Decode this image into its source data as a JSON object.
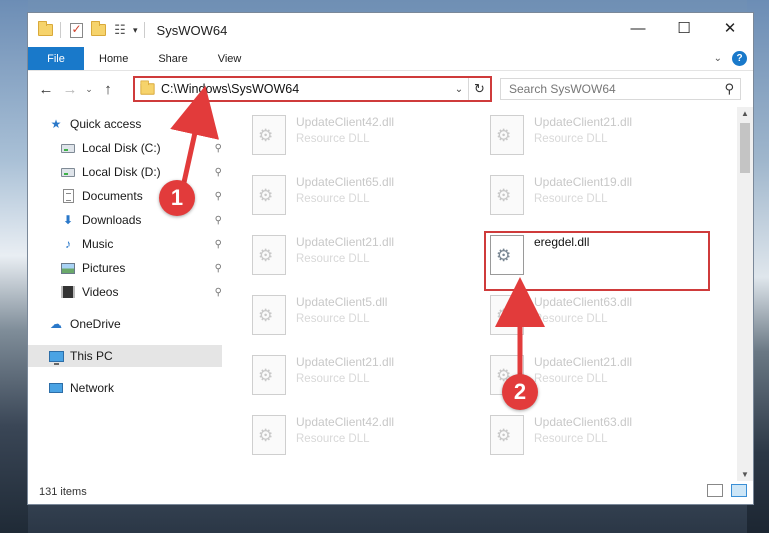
{
  "window": {
    "title": "SysWOW64"
  },
  "window_controls": {
    "minimize": "—",
    "maximize": "☐",
    "close": "✕"
  },
  "ribbon": {
    "tabs": [
      "File",
      "Home",
      "Share",
      "View"
    ],
    "collapse": "⌄",
    "help": "?"
  },
  "address_bar": {
    "path": "C:\\Windows\\SysWOW64",
    "dropdown": "⌄",
    "refresh": "↻"
  },
  "search": {
    "placeholder": "Search SysWOW64",
    "icon": "⚲"
  },
  "nav_buttons": {
    "back": "←",
    "forward": "→",
    "recent": "⌄",
    "up": "↑"
  },
  "sidebar": {
    "quick_access": "Quick access",
    "items": [
      {
        "label": "Local Disk (C:)",
        "icon": "drive-icon",
        "pinned": true
      },
      {
        "label": "Local Disk (D:)",
        "icon": "drive-icon",
        "pinned": true
      },
      {
        "label": "Documents",
        "icon": "documents-icon",
        "pinned": true
      },
      {
        "label": "Downloads",
        "icon": "downloads-icon",
        "pinned": true
      },
      {
        "label": "Music",
        "icon": "music-icon",
        "pinned": true
      },
      {
        "label": "Pictures",
        "icon": "pictures-icon",
        "pinned": true
      },
      {
        "label": "Videos",
        "icon": "videos-icon",
        "pinned": true
      }
    ],
    "onedrive": "OneDrive",
    "this_pc": "This PC",
    "network": "Network",
    "pin_glyph": "📌"
  },
  "files": [
    {
      "name": "UpdateClient42.dll",
      "type": "Resource DLL"
    },
    {
      "name": "UpdateClient21.dll",
      "type": "Resource DLL"
    },
    {
      "name": "UpdateClient65.dll",
      "type": "Resource DLL"
    },
    {
      "name": "UpdateClient19.dll",
      "type": "Resource DLL"
    },
    {
      "name": "UpdateClient21.dll",
      "type": "Resource DLL"
    },
    {
      "name": "eregdel.dll",
      "type": "",
      "highlighted": true
    },
    {
      "name": "UpdateClient5.dll",
      "type": "Resource DLL"
    },
    {
      "name": "UpdateClient63.dll",
      "type": "Resource DLL"
    },
    {
      "name": "UpdateClient21.dll",
      "type": "Resource DLL"
    },
    {
      "name": "UpdateClient21.dll",
      "type": "Resource DLL"
    },
    {
      "name": "UpdateClient42.dll",
      "type": "Resource DLL"
    },
    {
      "name": "UpdateClient63.dll",
      "type": "Resource DLL"
    }
  ],
  "status": {
    "item_count": "131 items"
  },
  "callouts": {
    "step1": "1",
    "step2": "2"
  },
  "colors": {
    "accent": "#1979ca",
    "highlight": "#cf3b3b",
    "callout": "#e23b3b"
  }
}
